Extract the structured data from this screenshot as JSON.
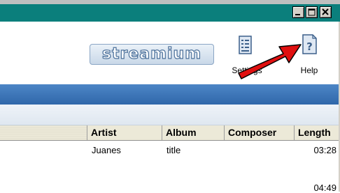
{
  "window": {
    "controls": [
      "minimize",
      "maximize",
      "close"
    ]
  },
  "toolbar": {
    "logo_text": "streamium",
    "settings_label": "Settings",
    "help_label": "Help"
  },
  "table": {
    "columns": [
      "Artist",
      "Album",
      "Composer",
      "Length"
    ],
    "rows": [
      {
        "artist": "Juanes",
        "album": "title",
        "composer": "",
        "length": "03:28"
      },
      {
        "artist": "",
        "album": "",
        "composer": "",
        "length": "04:49"
      }
    ]
  },
  "colors": {
    "titlebar": "#0b7f7c",
    "bluebar": "#3a73b6",
    "arrow": "#e01010"
  },
  "icons": [
    "minimize-icon",
    "maximize-icon",
    "close-icon",
    "settings-icon",
    "help-icon",
    "red-arrow-icon"
  ]
}
